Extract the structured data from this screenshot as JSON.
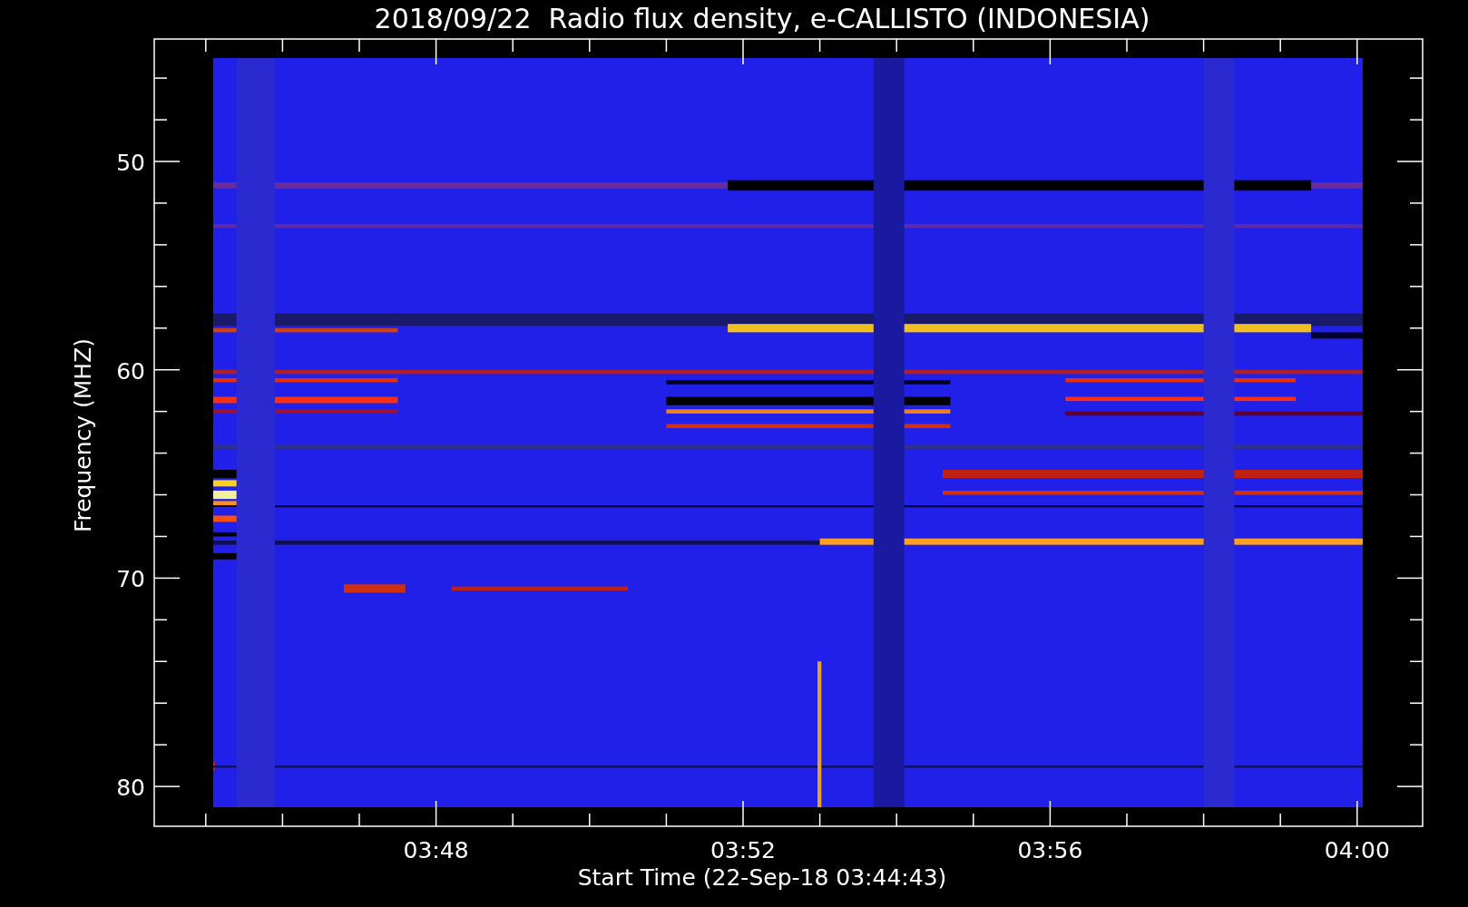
{
  "title": "2018/09/22  Radio flux density, e-CALLISTO (INDONESIA)",
  "y_axis": {
    "label": "Frequency (MHZ)",
    "ticks": [
      "50",
      "60",
      "70",
      "80"
    ]
  },
  "x_axis": {
    "label": "Start Time (22-Sep-18 03:44:43)",
    "ticks": [
      "03:48",
      "03:52",
      "03:56",
      "04:00"
    ]
  }
}
